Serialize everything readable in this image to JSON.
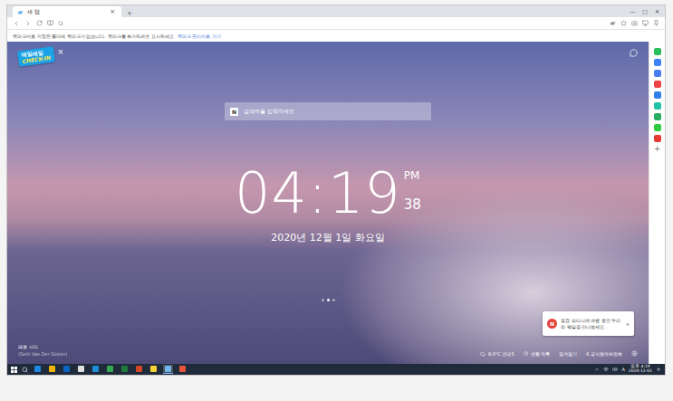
{
  "window": {
    "tabs": [
      {
        "label": "새 탭",
        "selected": true
      }
    ],
    "tab_close": "×",
    "new_tab": "+",
    "controls": [
      "—",
      "□",
      "✕"
    ]
  },
  "bookmarks_bar": {
    "message": "북마크바로 지정된 폴더에 북마크가 없습니다. 북마크를 추가하려면 표시하세요",
    "link": "북마크 관리자로 가기"
  },
  "new_tab_page": {
    "badge": {
      "line1": "매일매일",
      "line2": "CHECK-IN",
      "close": "×"
    },
    "search": {
      "logo": "N",
      "placeholder": "검색어를 입력하세요"
    },
    "clock": {
      "time": "04:19",
      "meridiem": "PM",
      "seconds": "38"
    },
    "date": "2020년 12월 1일 화요일",
    "slides": [
      {
        "selected": false
      },
      {
        "selected": true
      },
      {
        "selected": false
      }
    ],
    "photo_credit": {
      "place": "페로 시티",
      "author": "(Seth Van Der Sloten)"
    },
    "bottom_bar": [
      {
        "kind": "weather",
        "label": "8.0°C 건대5"
      },
      {
        "kind": "clock",
        "label": "생활 목록"
      },
      {
        "kind": "plain",
        "label": "즐겨찾기"
      },
      {
        "kind": "count",
        "label": "6 공식협력위원회"
      }
    ],
    "notification": {
      "logo": "N",
      "text": "즐겁 파티나며 여행 중인 우리의 웨일을 만나보세요.",
      "close": "×"
    }
  },
  "sidebar": {
    "items": [
      {
        "color": "#2bbf5b"
      },
      {
        "color": "#3b82f6"
      },
      {
        "color": "#4a7ef0"
      },
      {
        "color": "#ef4444"
      },
      {
        "color": "#2f80ed"
      },
      {
        "color": "#22c3a6"
      },
      {
        "color": "#27ae60"
      },
      {
        "color": "#2ecc40"
      },
      {
        "color": "#e53935"
      }
    ],
    "add": "+"
  },
  "taskbar": {
    "apps": [
      {
        "color": "#1e88e5",
        "selected": false
      },
      {
        "color": "#f4b400",
        "selected": false
      },
      {
        "color": "#0b63c5",
        "selected": false
      },
      {
        "color": "#e0e0e0",
        "selected": false
      },
      {
        "color": "#1f8cd6",
        "selected": false
      },
      {
        "color": "#34a853",
        "selected": false
      },
      {
        "color": "#1d7a3f",
        "selected": false
      },
      {
        "color": "#d24726",
        "selected": false
      },
      {
        "color": "#f7d033",
        "selected": false
      },
      {
        "color": "#6fb7e8",
        "selected": true
      },
      {
        "color": "#e8553b",
        "selected": false
      }
    ],
    "ime": "A",
    "time": "오후 4:19",
    "date": "2020-12-01"
  }
}
